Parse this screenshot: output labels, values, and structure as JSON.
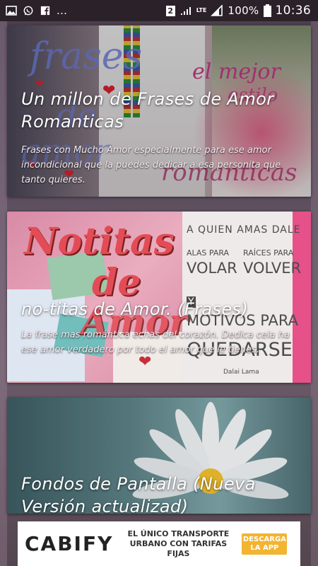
{
  "status_bar": {
    "sim_slot": "2",
    "network": "LTE",
    "battery": "100%",
    "time": "10:36",
    "overflow": "..."
  },
  "cards": [
    {
      "title": "Un millon de Frases de Amor Romanticas",
      "description": "Frases con Mucho Amor especialmente para ese amor incondicional que la puedes dedicar a esa personita que tanto quieres.",
      "art_text": [
        "frases",
        "de",
        "amor",
        "el mejor",
        "estilo",
        "romanticas"
      ]
    },
    {
      "title": "no-titas de Amor. (Frases)",
      "description": "La frase mas romántica echas del corazón. Dedica cela ha ese amor verdadero por todo el amor que le tienes.",
      "art_text": [
        "Notitas",
        "de",
        "Amor",
        "A QUIEN AMAS DALE",
        "ALAS PARA",
        "RAÍCES PARA",
        "VOLAR",
        "VOLVER",
        "Y",
        "MOTIVOS PARA",
        "QUEDARSE",
        "Dalai Lama"
      ]
    },
    {
      "title": "Fondos de Pantalla (Nueva Versión actualizad)",
      "description": ""
    }
  ],
  "ad": {
    "brand": "CABIFY",
    "tagline": "EL ÚNICO TRANSPORTE URBANO CON TARIFAS FIJAS",
    "cta": "DESCARGA LA APP"
  }
}
